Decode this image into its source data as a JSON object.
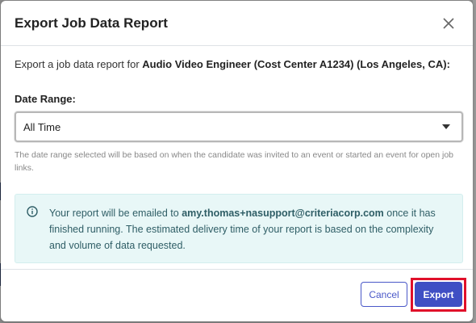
{
  "modal": {
    "title": "Export Job Data Report",
    "intro_prefix": "Export a job data report for ",
    "job_name": "Audio Video Engineer (Cost Center A1234) (Los Angeles, CA):",
    "date_range_label": "Date Range:",
    "date_range_value": "All Time",
    "help_text": "The date range selected will be based on when the candidate was invited to an event or started an event for open job links.",
    "info": {
      "prefix": "Your report will be emailed to ",
      "email": "amy.thomas+nasupport@criteriacorp.com",
      "suffix": " once it has finished running. The estimated delivery time of your report is based on the complexity and volume of data requested."
    },
    "cancel_label": "Cancel",
    "export_label": "Export"
  },
  "colors": {
    "primary": "#3f4fc4",
    "highlight": "#e0102a",
    "info_bg": "#e8f7f7",
    "info_text": "#2f5e66"
  },
  "icons": {
    "close": "close-icon",
    "info": "info-circle-icon",
    "dropdown": "caret-down-icon"
  }
}
